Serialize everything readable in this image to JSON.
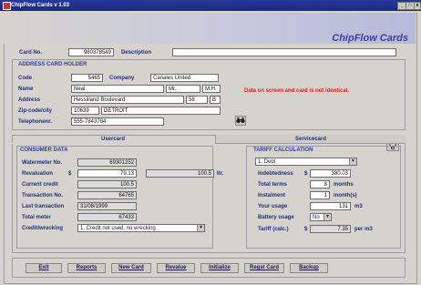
{
  "window": {
    "title": "ChipFlow Cards v 1.03",
    "minimize": "_",
    "maximize": "□",
    "close": "x"
  },
  "brand": "ChipFlow Cards",
  "card": {
    "no_label": "Card No.",
    "no_value": "980378549",
    "description_label": "Description",
    "description_value": ""
  },
  "holder": {
    "section": "ADDRESS CARD HOLDER",
    "code_label": "Code",
    "code_value": "5465",
    "company_label": "Company",
    "company_value": "Canales United",
    "name_label": "Name",
    "name_value": "Neal",
    "title_value": "Mr.",
    "initial_value": "M.H.",
    "address_label": "Address",
    "address_value": "Hessilland Boulevard",
    "house_no": "58",
    "house_suffix": "B",
    "zip_label": "Zip-code/city",
    "zip_value": "10639",
    "city_value": "DETROIT",
    "phone_label": "Telephonenr.",
    "phone_value": "555-7843784",
    "warning": "Data on screen and card is not identical."
  },
  "tabs": {
    "usercard": "Usercard",
    "servicecard": "Servicecard"
  },
  "consumer": {
    "section": "CONSUMER DATA",
    "watermeter_label": "Watermeter No.",
    "watermeter_value": "69301252",
    "revaluation_label": "Revaluation",
    "currency1": "$",
    "revaluation_value": "79.13",
    "revaluation_to": "100.5",
    "revaluation_unit": "ltr.",
    "credit_label": "Current credit",
    "credit_value": "100.5",
    "transaction_label": "Transaction No.",
    "transaction_value": "64765",
    "last_label": "Last transaction",
    "last_value": "31/08/1999",
    "meter_label": "Total meter",
    "meter_value": "67433",
    "wrecking_label": "Credit/wrecking",
    "wrecking_value": "1. Credit not used, no wrecking"
  },
  "tariff": {
    "section": "TARIFF CALCULATION",
    "type_value": "1. Debt",
    "indebtedness_label": "Indebtedness",
    "currency": "$",
    "indebtedness_value": "380.03",
    "terms_label": "Total terms",
    "terms_value": "8",
    "terms_unit": "months",
    "instalment_label": "Instalment",
    "instalment_value": "1",
    "instalment_unit": "month(s)",
    "usage_label": "Your usage",
    "usage_value": "131",
    "usage_unit": "m3",
    "battery_label": "Battery usage",
    "battery_value": "No",
    "tariff_label": "Tariff (calc.)",
    "tariff_value": "7.35",
    "tariff_unit": "per m3"
  },
  "buttons": {
    "exit": "Exit",
    "reports": "Reports",
    "new_card": "New Card",
    "revalue": "Revalue",
    "initialize": "Initialize",
    "regist_card": "Regst Card",
    "backup": "Backup"
  },
  "icons": {
    "binoculars": "binoculars-icon",
    "bulb": "bulb-icon"
  }
}
